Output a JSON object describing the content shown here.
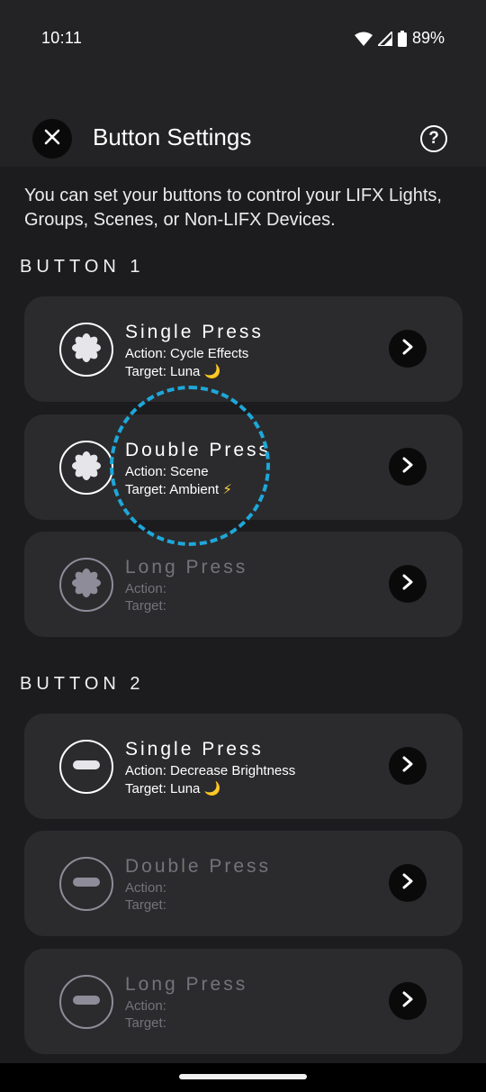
{
  "status_bar": {
    "time": "10:11",
    "battery": "89%"
  },
  "header": {
    "title": "Button Settings",
    "help_symbol": "?"
  },
  "intro": "You can set your buttons to control your LIFX Lights, Groups, Scenes, or Non-LIFX Devices.",
  "buttons": [
    {
      "label": "BUTTON 1",
      "icon": "flower-icon",
      "presses": [
        {
          "title": "Single Press",
          "action": "Action: Cycle Effects",
          "target": "Target: Luna",
          "target_emoji": "🌙",
          "configured": true
        },
        {
          "title": "Double Press",
          "action": "Action: Scene",
          "target": "Target: Ambient",
          "target_emoji": "⚡",
          "configured": true
        },
        {
          "title": "Long Press",
          "action": "Action:",
          "target": "Target:",
          "target_emoji": "",
          "configured": false
        }
      ]
    },
    {
      "label": "BUTTON 2",
      "icon": "minus-icon",
      "presses": [
        {
          "title": "Single Press",
          "action": "Action: Decrease Brightness",
          "target": "Target: Luna",
          "target_emoji": "🌙",
          "configured": true
        },
        {
          "title": "Double Press",
          "action": "Action:",
          "target": "Target:",
          "target_emoji": "",
          "configured": false
        },
        {
          "title": "Long Press",
          "action": "Action:",
          "target": "Target:",
          "target_emoji": "",
          "configured": false
        }
      ]
    }
  ],
  "colors": {
    "highlight": "#1ea7d9",
    "card": "#2b2b2d",
    "background": "#1c1c1f"
  }
}
